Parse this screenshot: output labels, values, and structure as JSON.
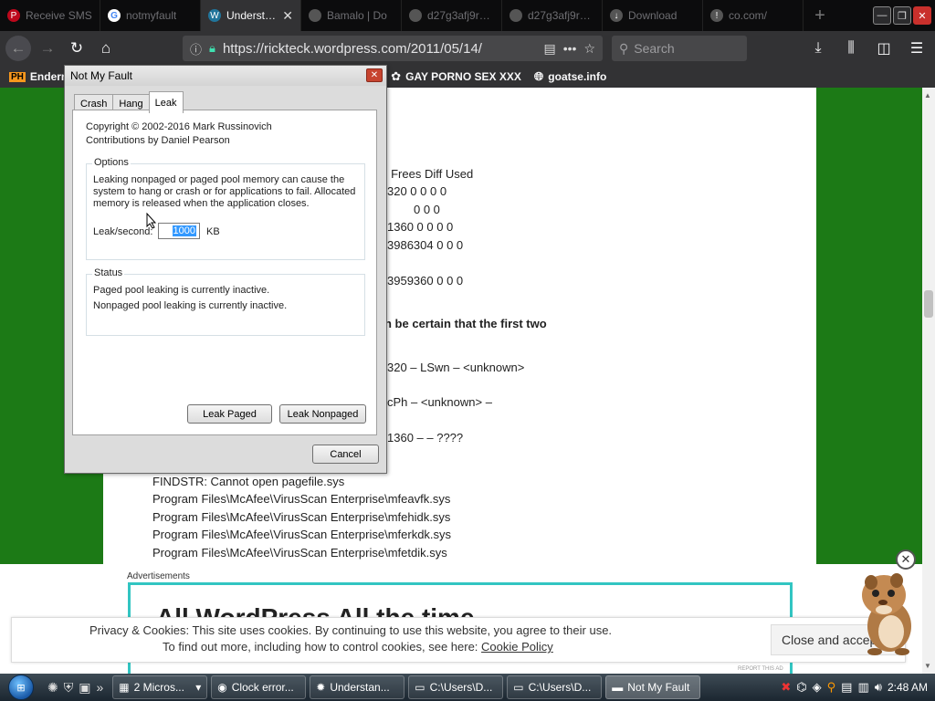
{
  "browser": {
    "tabs": [
      {
        "label": "Receive SMS",
        "icon": "pinterest-icon",
        "color": "#bd081c",
        "active": false
      },
      {
        "label": "notmyfault",
        "icon": "google-icon",
        "color": "#4285f4",
        "active": false
      },
      {
        "label": "Understan",
        "icon": "wordpress-icon",
        "color": "#21759b",
        "active": true
      },
      {
        "label": "Bamalo | Do",
        "icon": "page-icon",
        "color": "#888888",
        "active": false
      },
      {
        "label": "d27g3afj9rcpcq",
        "icon": "page-icon",
        "color": "#888888",
        "active": false
      },
      {
        "label": "d27g3afj9rcpcq",
        "icon": "page-icon",
        "color": "#888888",
        "active": false
      },
      {
        "label": "Download",
        "icon": "download-icon",
        "color": "#888888",
        "active": false
      },
      {
        "label": "co.com/",
        "icon": "warning-icon",
        "color": "#888888",
        "active": false
      }
    ],
    "url": "https://rickteck.wordpress.com/2011/05/14/",
    "search_placeholder": "Search",
    "bookmarks": [
      "Endern",
      "GAY PORNO SEX XXX",
      "goatse.info"
    ]
  },
  "article": {
    "lines": [
      {
        "text": "s    Frees    Diff    Used",
        "bold": false
      },
      {
        "text": "320       0       0       0       0",
        "bold": false
      },
      {
        "text": "0       0       0",
        "bold": false
      },
      {
        "text": "1360      0       0       0       0",
        "bold": false
      },
      {
        "text": "3986304      0       0       0",
        "bold": false
      },
      {
        "text": "3959360      0       0       0",
        "bold": false
      },
      {
        "text": "n be certain that the first two",
        "bold": true
      },
      {
        "text": "320     – LSwn – <unknown>",
        "bold": false
      },
      {
        "text": "cPh – <unknown>    –",
        "bold": false
      },
      {
        "text": "1360 –    – ????",
        "bold": false
      },
      {
        "text": "FINDSTR: Cannot open pagefile.sys",
        "bold": false
      },
      {
        "text": "Program Files\\McAfee\\VirusScan Enterprise\\mfeavfk.sys",
        "bold": false
      },
      {
        "text": "Program Files\\McAfee\\VirusScan Enterprise\\mfehidk.sys",
        "bold": false
      },
      {
        "text": "Program Files\\McAfee\\VirusScan Enterprise\\mferkdk.sys",
        "bold": false
      },
      {
        "text": "Program Files\\McAfee\\VirusScan Enterprise\\mfetdik.sys",
        "bold": false
      }
    ]
  },
  "ad": {
    "label": "Advertisements",
    "headline": "All WordPress All the time"
  },
  "cookie": {
    "line1": "Privacy & Cookies: This site uses cookies. By continuing to use this website, you agree to their use.",
    "line2": "To find out more, including how to control cookies, see here:",
    "link": "Cookie Policy",
    "button": "Close and accept"
  },
  "dialog": {
    "title": "Not My Fault",
    "tabs": [
      "Crash",
      "Hang",
      "Leak"
    ],
    "active_tab": "Leak",
    "copyright": "Copyright © 2002-2016 Mark Russinovich",
    "contributions": "Contributions by Daniel Pearson",
    "options_label": "Options",
    "options_text": [
      "Leaking nonpaged or paged pool memory can cause the",
      "system to hang or crash or for applications to fail. Allocated",
      "memory is released when the application closes."
    ],
    "leak_label": "Leak/second:",
    "leak_value": "1000",
    "leak_unit": "KB",
    "status_label": "Status",
    "status_paged": "Paged pool leaking is currently inactive.",
    "status_nonpaged": "Nonpaged pool leaking is currently inactive.",
    "btn_paged": "Leak Paged",
    "btn_nonpaged": "Leak Nonpaged",
    "btn_cancel": "Cancel"
  },
  "taskbar": {
    "items": [
      {
        "label": "2 Micros...",
        "icon": "word-icon",
        "active": false
      },
      {
        "label": "Clock error...",
        "icon": "chrome-icon",
        "active": false
      },
      {
        "label": "Understan...",
        "icon": "firefox-icon",
        "active": false
      },
      {
        "label": "C:\\Users\\D...",
        "icon": "cmd-icon",
        "active": false
      },
      {
        "label": "C:\\Users\\D...",
        "icon": "cmd-icon",
        "active": false
      },
      {
        "label": "Not My Fault",
        "icon": "app-icon",
        "active": true
      }
    ],
    "clock": "2:48 AM"
  },
  "colors": {
    "page_bg": "#1c7a16",
    "ad_border": "#32c5c2",
    "browser_chrome": "#323234"
  }
}
